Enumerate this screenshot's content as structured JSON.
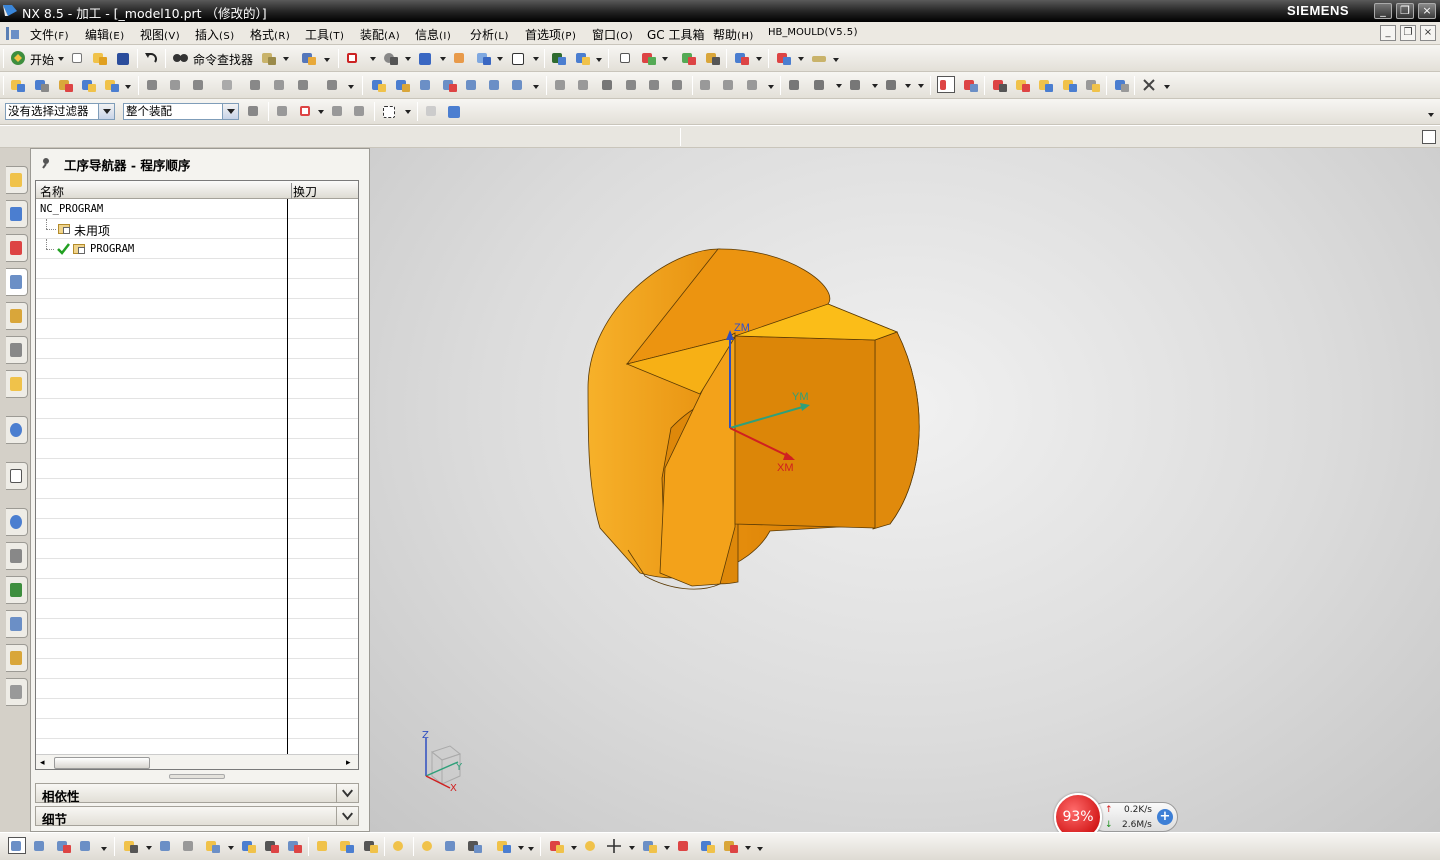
{
  "window": {
    "title": "NX 8.5 - 加工 - [_model10.prt （修改的）]",
    "brand": "SIEMENS",
    "controls": [
      "_",
      "❐",
      "×"
    ]
  },
  "menu": [
    {
      "label": "文件",
      "key": "(F)"
    },
    {
      "label": "编辑",
      "key": "(E)"
    },
    {
      "label": "视图",
      "key": "(V)"
    },
    {
      "label": "插入",
      "key": "(S)"
    },
    {
      "label": "格式",
      "key": "(R)"
    },
    {
      "label": "工具",
      "key": "(T)"
    },
    {
      "label": "装配",
      "key": "(A)"
    },
    {
      "label": "信息",
      "key": "(I)"
    },
    {
      "label": "分析",
      "key": "(L)"
    },
    {
      "label": "首选项",
      "key": "(P)"
    },
    {
      "label": "窗口",
      "key": "(O)"
    },
    {
      "label": "GC 工具箱",
      "key": ""
    },
    {
      "label": "帮助",
      "key": "(H)"
    },
    {
      "label": "HB_MOULD",
      "key": "(V5.5)"
    }
  ],
  "toolbar": {
    "start_label": "开始",
    "command_finder_label": "命令查找器",
    "filter_combo": "没有选择过滤器",
    "assembly_combo": "整个装配"
  },
  "navigator": {
    "title": "工序导航器 - 程序顺序",
    "col_name": "名称",
    "col_toolchange": "换刀",
    "rows": [
      {
        "name": "NC_PROGRAM"
      },
      {
        "name": "未用项"
      },
      {
        "name": "PROGRAM"
      }
    ],
    "panel_dependency": "相依性",
    "panel_details": "细节"
  },
  "viewport": {
    "axis_zm": "ZM",
    "axis_ym": "YM",
    "axis_xm": "XM",
    "triad_z": "Z",
    "triad_y": "Y",
    "triad_x": "X",
    "model_color": "#f3a21a"
  },
  "netmeter": {
    "percent": "93%",
    "upload": "0.2K/s",
    "download": "2.6M/s",
    "up_arrow": "↑",
    "down_arrow": "↓",
    "plus": "+"
  }
}
